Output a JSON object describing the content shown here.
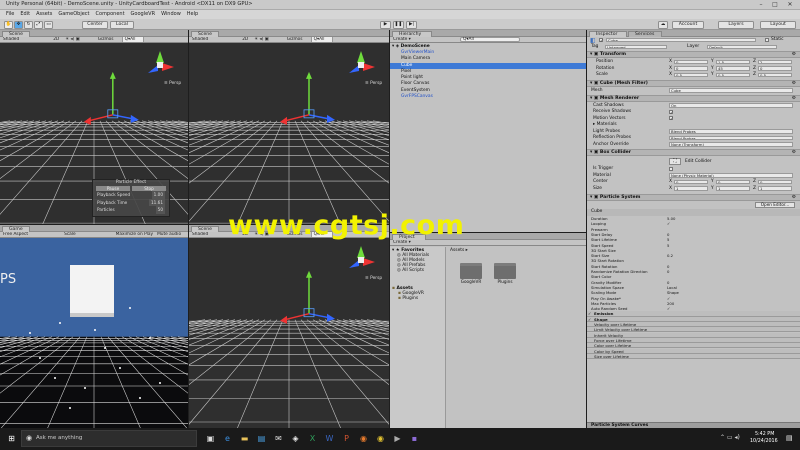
{
  "window": {
    "title": "Unity Personal (64bit) - DemoScene.unity - UnityCardboardTest - Android <DX11 on DX9 GPU>"
  },
  "menu": [
    "File",
    "Edit",
    "Assets",
    "GameObject",
    "Component",
    "GoogleVR",
    "Window",
    "Help"
  ],
  "toolbar": {
    "center": "Center",
    "local": "Local",
    "play": "▶",
    "pause": "❚❚",
    "step": "▶|",
    "account": "Account",
    "layers": "Layers",
    "layout": "Layout"
  },
  "scene_tabs": {
    "scene": "Scene",
    "game": "Game",
    "hierarchy": "Hierarchy",
    "inspector": "Inspector",
    "services": "Services"
  },
  "scene_toolbar": {
    "shaded": "Shaded",
    "mode2d": "2D",
    "gizmos": "Gizmos",
    "search_placeholder": "Q▾All"
  },
  "game_toolbar": {
    "display": "Free Aspect",
    "scale": "Scale",
    "maximize": "Maximize on Play",
    "mute": "Mute audio"
  },
  "persp_label": "≡ Persp",
  "particle_effect": {
    "title": "Particle Effect",
    "pause": "Pause",
    "stop": "Stop",
    "rows": [
      {
        "label": "Playback Speed",
        "value": "1.00"
      },
      {
        "label": "Playback Time",
        "value": "11.61"
      },
      {
        "label": "Particles",
        "value": "50"
      }
    ]
  },
  "game_overlay_text": "PS",
  "hierarchy": {
    "create": "Create ▾",
    "search": "Q▾All",
    "scene": "DemoScene",
    "items": [
      {
        "label": "GvrViewerMain",
        "style": "blue",
        "indent": 1
      },
      {
        "label": "Main Camera",
        "style": "normal",
        "indent": 1
      },
      {
        "label": "Cube",
        "style": "selected",
        "indent": 1
      },
      {
        "label": "Pixel",
        "style": "normal",
        "indent": 1
      },
      {
        "label": "Point light",
        "style": "normal",
        "indent": 1
      },
      {
        "label": "Floor Canvas",
        "style": "normal",
        "indent": 1
      },
      {
        "label": "EventSystem",
        "style": "normal",
        "indent": 1
      },
      {
        "label": "GvrFPSCanvas",
        "style": "blue",
        "indent": 1
      }
    ]
  },
  "project": {
    "tab": "Project",
    "create": "Create ▾",
    "favorites": "Favorites",
    "fav_items": [
      "All Materials",
      "All Models",
      "All Prefabs",
      "All Scripts"
    ],
    "assets_root": "Assets",
    "tree": [
      "Assets",
      "GoogleVR",
      "Plugins"
    ],
    "breadcrumb": "Assets ▸",
    "folders": [
      "GoogleVR",
      "Plugins"
    ]
  },
  "inspector": {
    "object_name": "Cube",
    "static": "Static",
    "tag_label": "Tag",
    "tag": "Untagged",
    "layer_label": "Layer",
    "layer": "Default",
    "transform": {
      "title": "Transform",
      "rows": [
        {
          "label": "Position",
          "x": "0",
          "y": "1.5",
          "z": "2"
        },
        {
          "label": "Rotation",
          "x": "0",
          "y": "45",
          "z": "0"
        },
        {
          "label": "Scale",
          "x": "0.5",
          "y": "0.5",
          "z": "0.5"
        }
      ]
    },
    "mesh_filter": {
      "title": "Cube (Mesh Filter)",
      "mesh_label": "Mesh",
      "mesh": "Cube"
    },
    "mesh_renderer": {
      "title": "Mesh Renderer",
      "rows": [
        {
          "label": "Cast Shadows",
          "value": "On",
          "type": "field"
        },
        {
          "label": "Receive Shadows",
          "value": "✓",
          "type": "check"
        },
        {
          "label": "Motion Vectors",
          "value": "✓",
          "type": "check"
        },
        {
          "label": "▸ Materials",
          "value": "",
          "type": "none"
        },
        {
          "label": "Light Probes",
          "value": "Blend Probes",
          "type": "field"
        },
        {
          "label": "Reflection Probes",
          "value": "Blend Probes",
          "type": "field"
        },
        {
          "label": "Anchor Override",
          "value": "None (Transform)",
          "type": "field"
        }
      ]
    },
    "box_collider": {
      "title": "Box Collider",
      "edit": "Edit Collider",
      "rows": [
        {
          "label": "Is Trigger",
          "value": "",
          "type": "check"
        },
        {
          "label": "Material",
          "value": "None (Physic Material)",
          "type": "field"
        }
      ],
      "center": {
        "label": "Center",
        "x": "0",
        "y": "0",
        "z": "0"
      },
      "size": {
        "label": "Size",
        "x": "1",
        "y": "1",
        "z": "1"
      }
    },
    "particle_system": {
      "title": "Particle System",
      "open_editor": "Open Editor...",
      "sub": "Cube",
      "rows": [
        {
          "label": "Duration",
          "value": "5.00"
        },
        {
          "label": "Looping",
          "value": "✓"
        },
        {
          "label": "Prewarm",
          "value": ""
        },
        {
          "label": "Start Delay",
          "value": "0"
        },
        {
          "label": "Start Lifetime",
          "value": "5"
        },
        {
          "label": "Start Speed",
          "value": "5"
        },
        {
          "label": "3D Start Size",
          "value": ""
        },
        {
          "label": "Start Size",
          "value": "0.2"
        },
        {
          "label": "3D Start Rotation",
          "value": ""
        },
        {
          "label": "Start Rotation",
          "value": "0"
        },
        {
          "label": "Randomize Rotation Direction",
          "value": "0"
        },
        {
          "label": "Start Color",
          "value": ""
        },
        {
          "label": "Gravity Modifier",
          "value": "0"
        },
        {
          "label": "Simulation Space",
          "value": "Local"
        },
        {
          "label": "Scaling Mode",
          "value": "Shape"
        },
        {
          "label": "Play On Awake*",
          "value": "✓"
        },
        {
          "label": "Max Particles",
          "value": "200"
        },
        {
          "label": "Auto Random Seed",
          "value": "✓"
        }
      ],
      "modules": [
        "Emission",
        "Shape",
        "Velocity over Lifetime",
        "Limit Velocity over Lifetime",
        "Inherit Velocity",
        "Force over Lifetime",
        "Color over Lifetime",
        "Color by Speed",
        "Size over Lifetime"
      ],
      "curves": "Particle System Curves"
    }
  },
  "watermark": "www.cgtsj.com",
  "taskbar": {
    "search": "Ask me anything",
    "time": "5:42 PM",
    "date": "10/24/2016"
  }
}
